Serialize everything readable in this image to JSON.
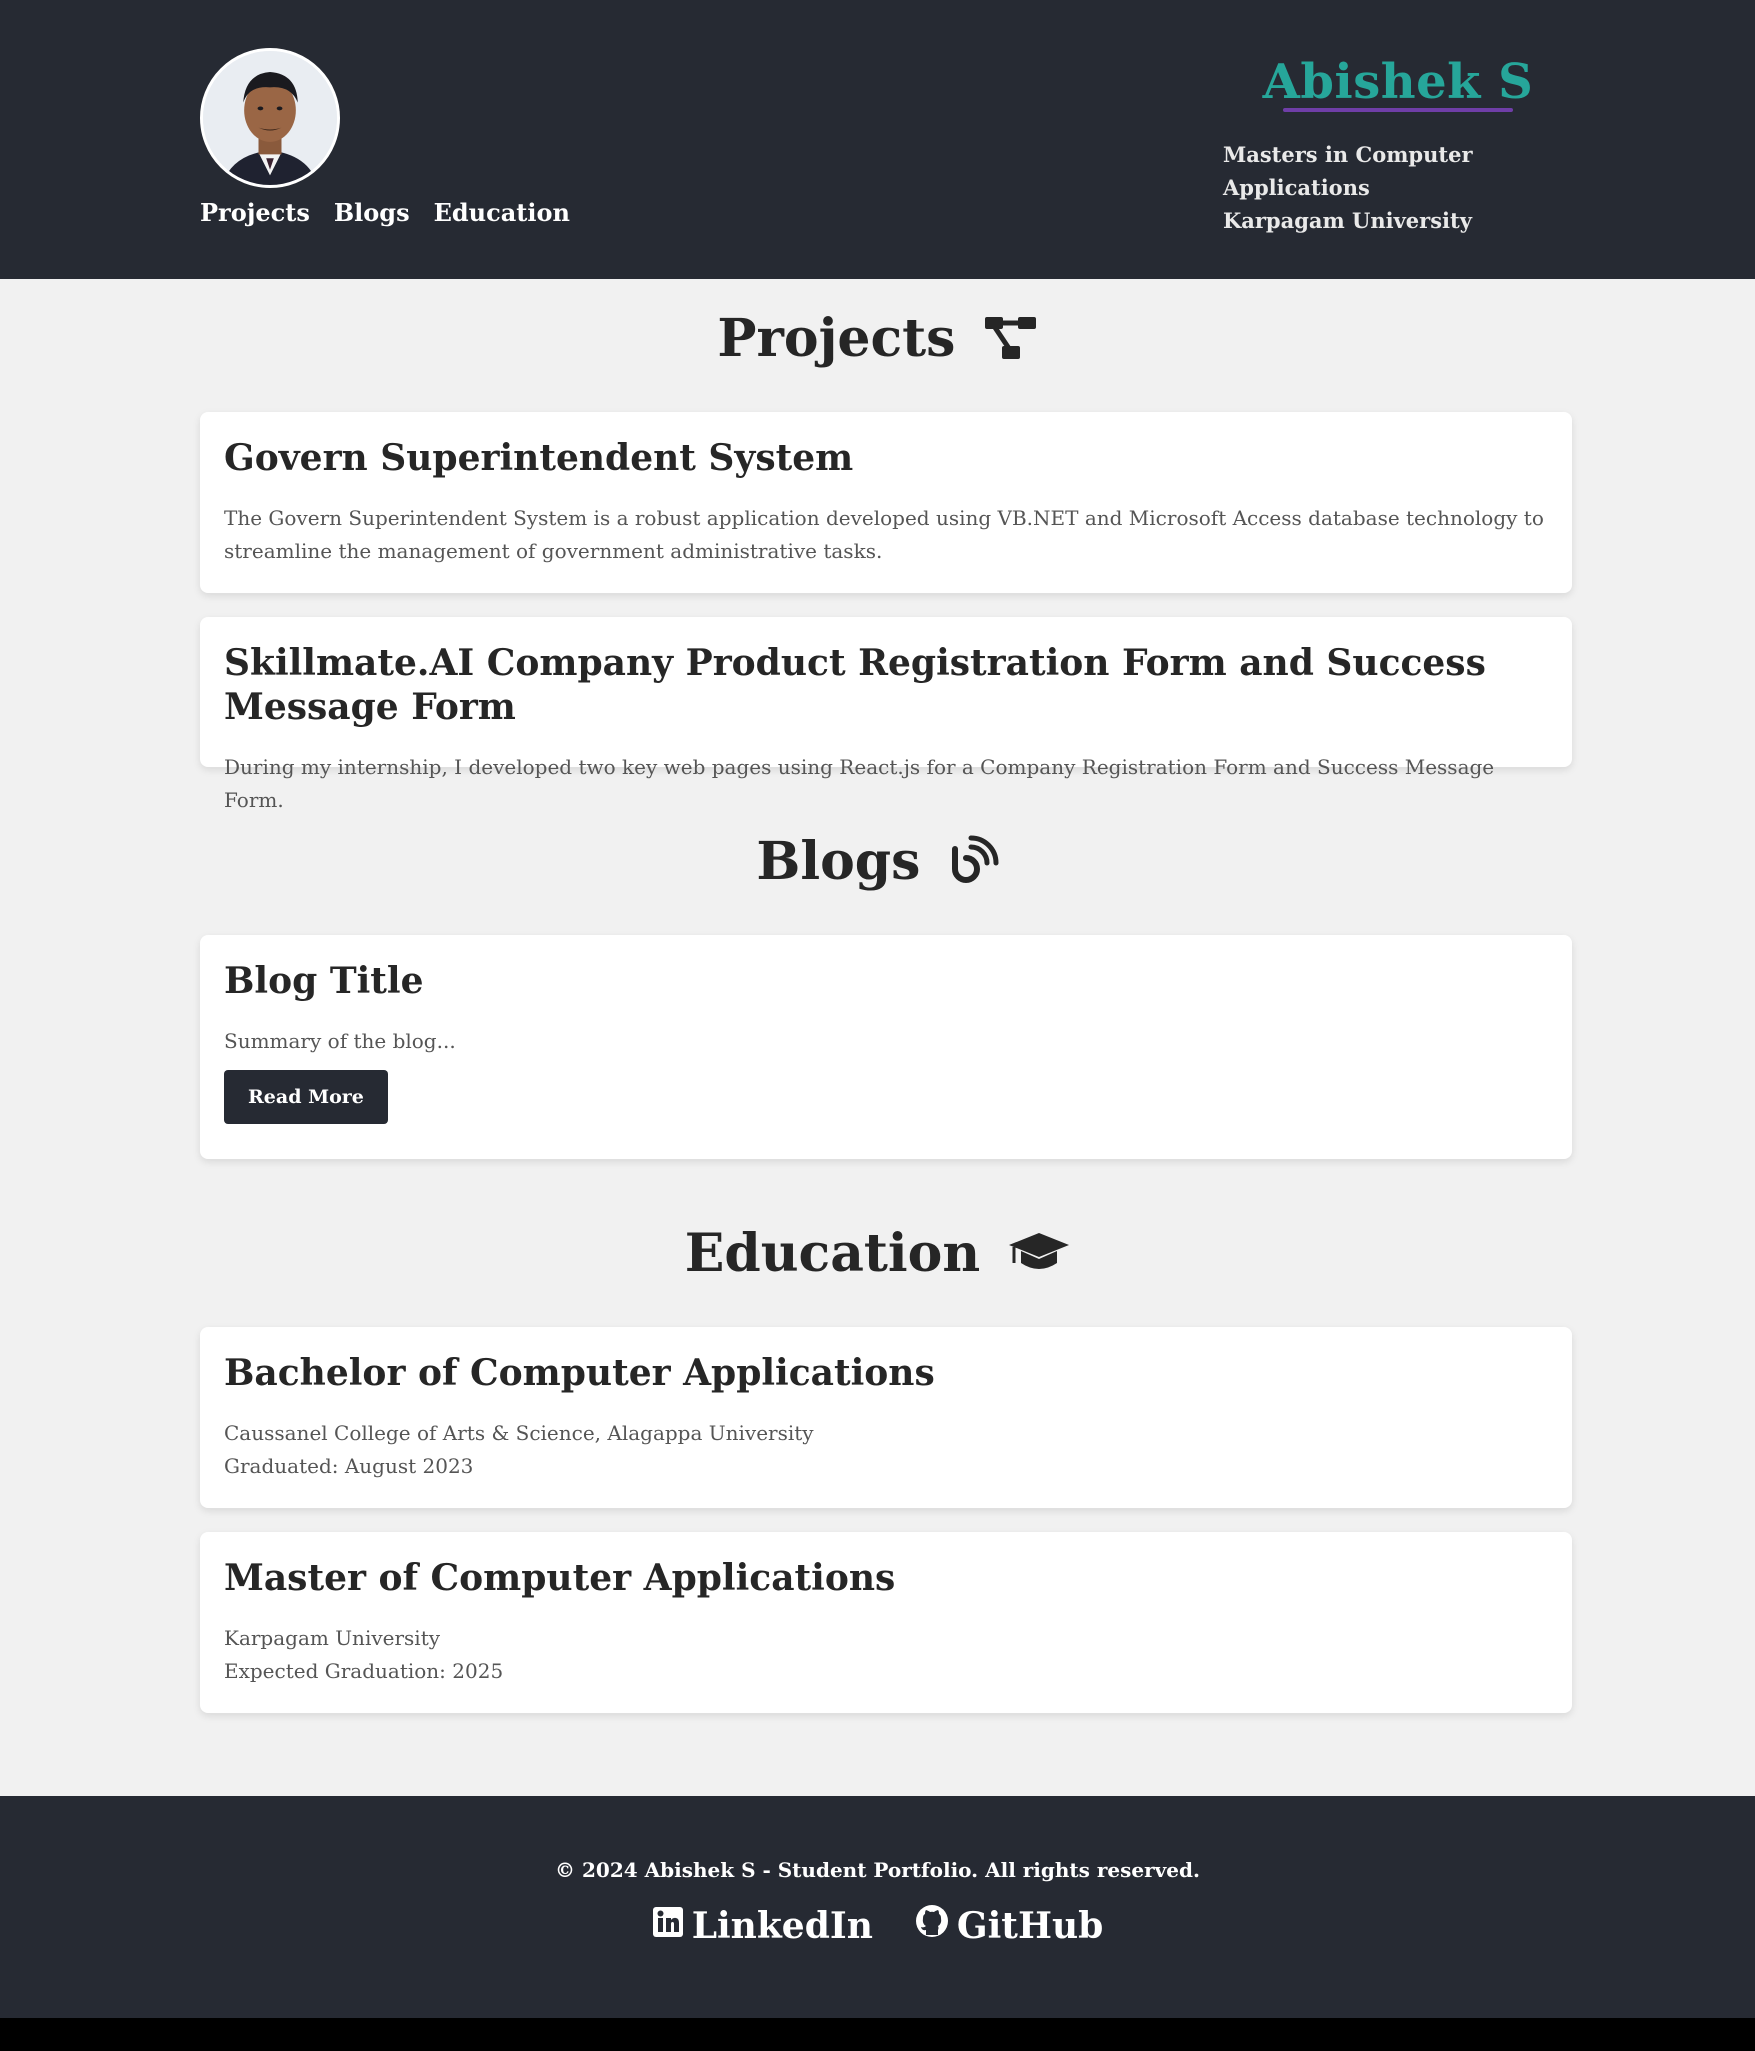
{
  "header": {
    "name": "Abishek S",
    "subtitle_line1": "Masters in Computer Applications",
    "subtitle_line2": "Karpagam University",
    "nav": [
      {
        "label": "Projects"
      },
      {
        "label": "Blogs"
      },
      {
        "label": "Education"
      }
    ],
    "colors": {
      "background": "#262a33",
      "name": "#26a69a",
      "underline": "#6f3ea8"
    }
  },
  "projects": {
    "title": "Projects",
    "icon": "project-diagram-icon",
    "items": [
      {
        "title": "Govern Superintendent System",
        "description": "The Govern Superintendent System is a robust application developed using VB.NET and Microsoft Access database technology to streamline the management of government administrative tasks."
      },
      {
        "title": "Skillmate.AI Company Product Registration Form and Success Message Form",
        "description": "During my internship, I developed two key web pages using React.js for a Company Registration Form and Success Message Form."
      }
    ]
  },
  "blogs": {
    "title": "Blogs",
    "icon": "blog-icon",
    "items": [
      {
        "title": "Blog Title",
        "summary": "Summary of the blog...",
        "button": "Read More"
      }
    ]
  },
  "education": {
    "title": "Education",
    "icon": "graduation-cap-icon",
    "items": [
      {
        "title": "Bachelor of Computer Applications",
        "institution": "Caussanel College of Arts & Science, Alagappa University",
        "graduation": "Graduated: August 2023"
      },
      {
        "title": "Master of Computer Applications",
        "institution": "Karpagam University",
        "graduation": "Expected Graduation: 2025"
      }
    ]
  },
  "footer": {
    "copyright": "© 2024 Abishek S - Student Portfolio. All rights reserved.",
    "links": [
      {
        "label": "LinkedIn",
        "icon": "linkedin-icon"
      },
      {
        "label": "GitHub",
        "icon": "github-icon"
      }
    ]
  }
}
